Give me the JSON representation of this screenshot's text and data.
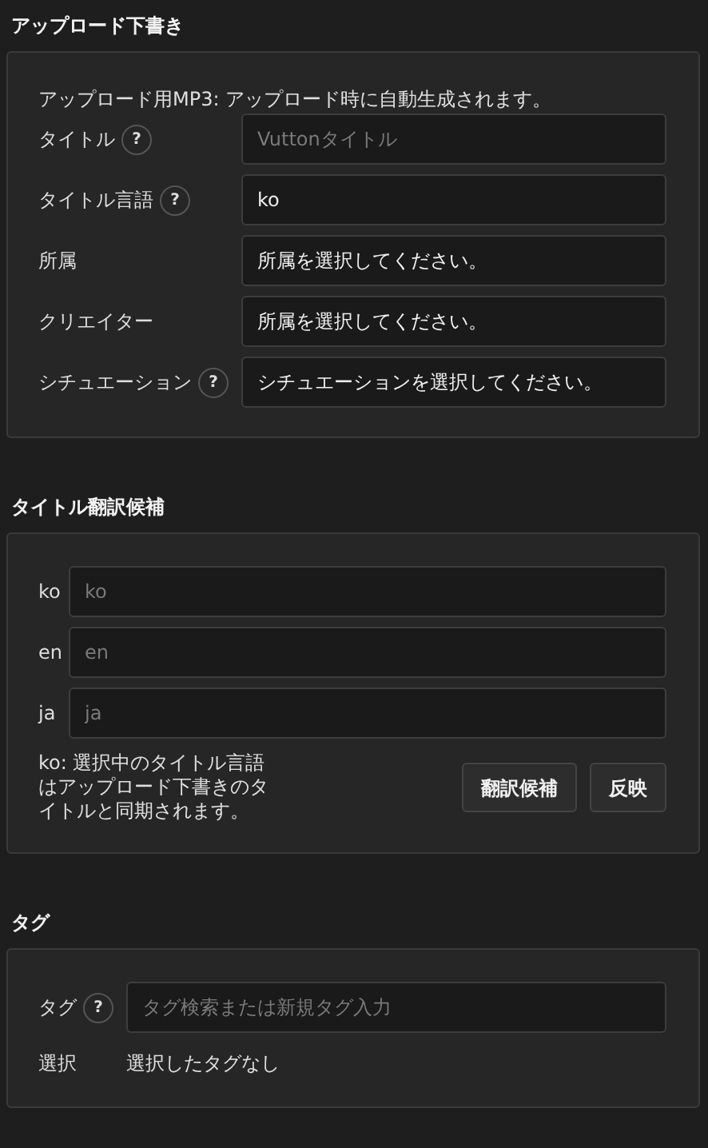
{
  "draft": {
    "title": "アップロード下書き",
    "note": "アップロード用MP3: アップロード時に自動生成されます。",
    "fields": [
      {
        "label": "タイトル",
        "help": "?",
        "placeholder": "Vuttonタイトル"
      },
      {
        "label": "タイトル言語",
        "help": "?",
        "value": "ko"
      },
      {
        "label": "所属",
        "value": "所属を選択してください。"
      },
      {
        "label": "クリエイター",
        "value": "所属を選択してください。"
      },
      {
        "label": "シチュエーション",
        "help": "?",
        "value": "シチュエーションを選択してください。"
      }
    ]
  },
  "translation": {
    "title": "タイトル翻訳候補",
    "fields": [
      {
        "label": "ko",
        "placeholder": "ko"
      },
      {
        "label": "en",
        "placeholder": "en"
      },
      {
        "label": "ja",
        "placeholder": "ja"
      }
    ],
    "note": "ko: 選択中のタイトル言語はアップロード下書きのタイトルと同期されます。",
    "buttons": [
      "翻訳候補",
      "反映"
    ]
  },
  "tags": {
    "title": "タグ",
    "field": {
      "label": "タグ",
      "help": "?",
      "placeholder": "タグ検索または新規タグ入力"
    },
    "selection": {
      "label": "選択",
      "value": "選択したタグなし"
    }
  }
}
